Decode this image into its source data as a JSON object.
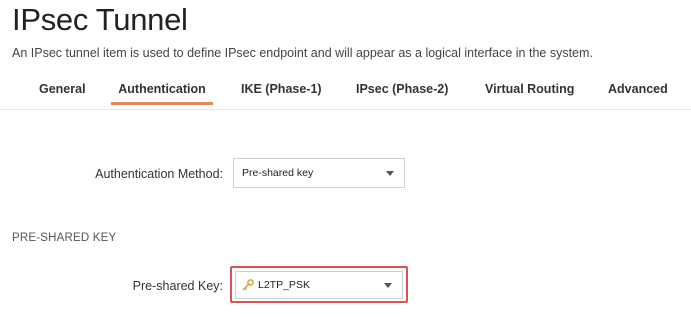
{
  "page": {
    "title": "IPsec Tunnel",
    "description": "An IPsec tunnel item is used to define IPsec endpoint and will appear as a logical interface in the system."
  },
  "tabs": [
    {
      "label": "General",
      "active": false
    },
    {
      "label": "Authentication",
      "active": true
    },
    {
      "label": "IKE (Phase-1)",
      "active": false
    },
    {
      "label": "IPsec (Phase-2)",
      "active": false
    },
    {
      "label": "Virtual Routing",
      "active": false
    },
    {
      "label": "Advanced",
      "active": false
    }
  ],
  "auth_method": {
    "label": "Authentication Method:",
    "value": "Pre-shared key"
  },
  "psk_section": {
    "heading": "PRE-SHARED KEY",
    "key_label": "Pre-shared Key:",
    "key_value": "L2TP_PSK",
    "key_icon": "key-icon"
  },
  "colors": {
    "active_tab_underline": "#e08a5b",
    "highlight_border": "#d9534f",
    "key_icon": "#e0a13a"
  }
}
